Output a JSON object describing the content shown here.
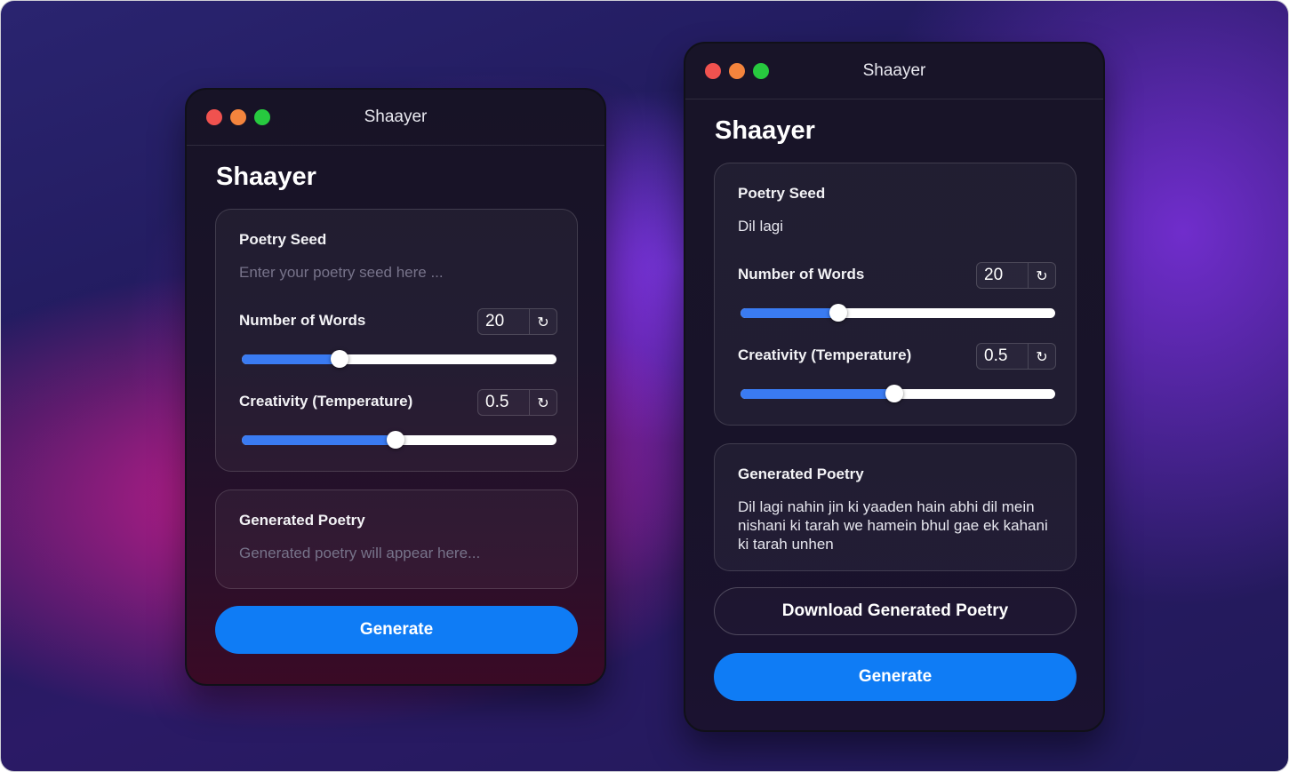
{
  "windows": [
    {
      "title": "Shaayer",
      "heading": "Shaayer",
      "seed_label": "Poetry Seed",
      "seed_placeholder": "Enter your poetry seed here ...",
      "words_label": "Number of Words",
      "words_value": "20",
      "words_fraction": 0.31,
      "temp_label": "Creativity (Temperature)",
      "temp_value": "0.5",
      "temp_fraction": 0.49,
      "output_label": "Generated Poetry",
      "output_placeholder": "Generated poetry will appear here...",
      "generate_label": "Generate"
    },
    {
      "title": "Shaayer",
      "heading": "Shaayer",
      "seed_label": "Poetry Seed",
      "seed_value": "Dil lagi",
      "words_label": "Number of Words",
      "words_value": "20",
      "words_fraction": 0.31,
      "temp_label": "Creativity (Temperature)",
      "temp_value": "0.5",
      "temp_fraction": 0.49,
      "output_label": "Generated Poetry",
      "output_text": "Dil lagi nahin jin ki yaaden hain abhi dil mein nishani ki tarah we hamein bhul gae ek kahani ki tarah unhen",
      "download_label": "Download Generated Poetry",
      "generate_label": "Generate"
    }
  ],
  "icons": {
    "reset": "↻"
  },
  "colors": {
    "accent": "#0f7cf5",
    "slider_fill": "#3a7bf2",
    "close": "#f0524f",
    "minimize": "#f4843d",
    "maximize": "#27c93f"
  }
}
